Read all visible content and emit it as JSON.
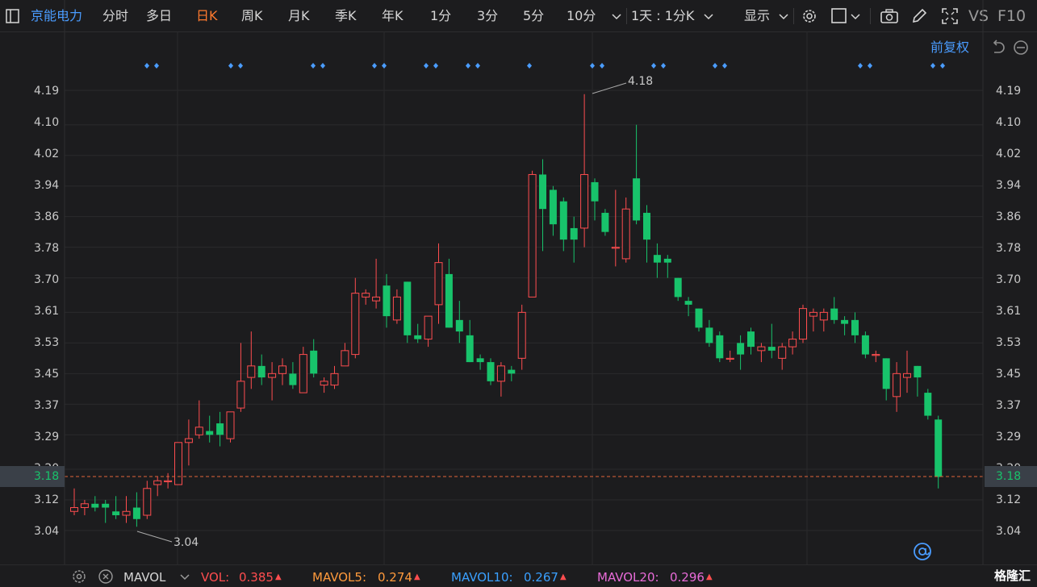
{
  "toolbar": {
    "stock_name": "京能电力",
    "periods": [
      "分时",
      "多日",
      "日K",
      "周K",
      "月K",
      "季K",
      "年K",
      "1分",
      "3分",
      "5分",
      "10分"
    ],
    "active_period": "日K",
    "multi_period": "1天 : 1分K",
    "display_label": "显示",
    "vs_label": "VS",
    "f10_label": "F10"
  },
  "subbar": {
    "adjust_label": "前复权"
  },
  "axis": {
    "ticks": [
      "4.19",
      "4.10",
      "4.02",
      "3.94",
      "3.86",
      "3.78",
      "3.70",
      "3.61",
      "3.53",
      "3.45",
      "3.37",
      "3.29",
      "3.20",
      "3.12",
      "3.04"
    ],
    "current_price": "3.18"
  },
  "annotations": {
    "high": "4.18",
    "low": "3.04"
  },
  "indicator": {
    "name": "MAVOL",
    "items": [
      {
        "label": "VOL:",
        "value": "0.385",
        "color": "#ff4d4f"
      },
      {
        "label": "MAVOL5:",
        "value": "0.274",
        "color": "#ff9a3c"
      },
      {
        "label": "MAVOL10:",
        "value": "0.267",
        "color": "#3aa0ff"
      },
      {
        "label": "MAVOL20:",
        "value": "0.296",
        "color": "#e86bd8"
      }
    ]
  },
  "brand": "格隆汇",
  "colors": {
    "up": "#ff4d4f",
    "down": "#18c36b",
    "accent": "#4a9cff",
    "grid": "#2a2a2c"
  },
  "chart_data": {
    "type": "candlestick",
    "ylim": [
      3.0,
      4.22
    ],
    "candles": [
      {
        "o": 3.09,
        "h": 3.15,
        "l": 3.08,
        "c": 3.1
      },
      {
        "o": 3.1,
        "h": 3.12,
        "l": 3.08,
        "c": 3.11
      },
      {
        "o": 3.11,
        "h": 3.13,
        "l": 3.09,
        "c": 3.1
      },
      {
        "o": 3.11,
        "h": 3.12,
        "l": 3.06,
        "c": 3.1
      },
      {
        "o": 3.09,
        "h": 3.13,
        "l": 3.07,
        "c": 3.08
      },
      {
        "o": 3.08,
        "h": 3.13,
        "l": 3.06,
        "c": 3.09
      },
      {
        "o": 3.1,
        "h": 3.14,
        "l": 3.05,
        "c": 3.07
      },
      {
        "o": 3.08,
        "h": 3.17,
        "l": 3.07,
        "c": 3.15
      },
      {
        "o": 3.16,
        "h": 3.18,
        "l": 3.13,
        "c": 3.17
      },
      {
        "o": 3.17,
        "h": 3.19,
        "l": 3.15,
        "c": 3.17
      },
      {
        "o": 3.16,
        "h": 3.26,
        "l": 3.16,
        "c": 3.27
      },
      {
        "o": 3.27,
        "h": 3.33,
        "l": 3.21,
        "c": 3.28
      },
      {
        "o": 3.29,
        "h": 3.38,
        "l": 3.28,
        "c": 3.31
      },
      {
        "o": 3.3,
        "h": 3.34,
        "l": 3.27,
        "c": 3.29
      },
      {
        "o": 3.32,
        "h": 3.35,
        "l": 3.26,
        "c": 3.29
      },
      {
        "o": 3.28,
        "h": 3.35,
        "l": 3.27,
        "c": 3.35
      },
      {
        "o": 3.36,
        "h": 3.53,
        "l": 3.35,
        "c": 3.43
      },
      {
        "o": 3.44,
        "h": 3.56,
        "l": 3.41,
        "c": 3.47
      },
      {
        "o": 3.47,
        "h": 3.5,
        "l": 3.42,
        "c": 3.44
      },
      {
        "o": 3.44,
        "h": 3.48,
        "l": 3.38,
        "c": 3.45
      },
      {
        "o": 3.45,
        "h": 3.49,
        "l": 3.42,
        "c": 3.47
      },
      {
        "o": 3.45,
        "h": 3.48,
        "l": 3.41,
        "c": 3.42
      },
      {
        "o": 3.4,
        "h": 3.52,
        "l": 3.4,
        "c": 3.5
      },
      {
        "o": 3.51,
        "h": 3.54,
        "l": 3.44,
        "c": 3.45
      },
      {
        "o": 3.42,
        "h": 3.44,
        "l": 3.4,
        "c": 3.43
      },
      {
        "o": 3.42,
        "h": 3.47,
        "l": 3.41,
        "c": 3.45
      },
      {
        "o": 3.47,
        "h": 3.53,
        "l": 3.47,
        "c": 3.51
      },
      {
        "o": 3.5,
        "h": 3.7,
        "l": 3.49,
        "c": 3.66
      },
      {
        "o": 3.65,
        "h": 3.67,
        "l": 3.63,
        "c": 3.66
      },
      {
        "o": 3.64,
        "h": 3.75,
        "l": 3.62,
        "c": 3.65
      },
      {
        "o": 3.68,
        "h": 3.71,
        "l": 3.57,
        "c": 3.6
      },
      {
        "o": 3.59,
        "h": 3.67,
        "l": 3.58,
        "c": 3.65
      },
      {
        "o": 3.69,
        "h": 3.69,
        "l": 3.53,
        "c": 3.55
      },
      {
        "o": 3.55,
        "h": 3.58,
        "l": 3.53,
        "c": 3.54
      },
      {
        "o": 3.54,
        "h": 3.59,
        "l": 3.52,
        "c": 3.6
      },
      {
        "o": 3.63,
        "h": 3.79,
        "l": 3.58,
        "c": 3.74
      },
      {
        "o": 3.71,
        "h": 3.75,
        "l": 3.57,
        "c": 3.57
      },
      {
        "o": 3.59,
        "h": 3.64,
        "l": 3.53,
        "c": 3.56
      },
      {
        "o": 3.55,
        "h": 3.59,
        "l": 3.48,
        "c": 3.48
      },
      {
        "o": 3.49,
        "h": 3.5,
        "l": 3.46,
        "c": 3.48
      },
      {
        "o": 3.48,
        "h": 3.49,
        "l": 3.42,
        "c": 3.43
      },
      {
        "o": 3.43,
        "h": 3.48,
        "l": 3.39,
        "c": 3.47
      },
      {
        "o": 3.46,
        "h": 3.47,
        "l": 3.43,
        "c": 3.45
      },
      {
        "o": 3.49,
        "h": 3.63,
        "l": 3.46,
        "c": 3.61
      },
      {
        "o": 3.65,
        "h": 3.98,
        "l": 3.65,
        "c": 3.97
      },
      {
        "o": 3.97,
        "h": 4.01,
        "l": 3.77,
        "c": 3.88
      },
      {
        "o": 3.93,
        "h": 3.94,
        "l": 3.81,
        "c": 3.84
      },
      {
        "o": 3.9,
        "h": 3.91,
        "l": 3.77,
        "c": 3.8
      },
      {
        "o": 3.83,
        "h": 3.86,
        "l": 3.74,
        "c": 3.8
      },
      {
        "o": 3.83,
        "h": 4.18,
        "l": 3.78,
        "c": 3.97
      },
      {
        "o": 3.95,
        "h": 3.96,
        "l": 3.85,
        "c": 3.9
      },
      {
        "o": 3.87,
        "h": 3.88,
        "l": 3.81,
        "c": 3.82
      },
      {
        "o": 3.78,
        "h": 3.93,
        "l": 3.73,
        "c": 3.78
      },
      {
        "o": 3.75,
        "h": 3.91,
        "l": 3.74,
        "c": 3.88
      },
      {
        "o": 3.96,
        "h": 4.1,
        "l": 3.84,
        "c": 3.85
      },
      {
        "o": 3.87,
        "h": 3.89,
        "l": 3.74,
        "c": 3.8
      },
      {
        "o": 3.76,
        "h": 3.79,
        "l": 3.7,
        "c": 3.74
      },
      {
        "o": 3.75,
        "h": 3.76,
        "l": 3.7,
        "c": 3.74
      },
      {
        "o": 3.7,
        "h": 3.7,
        "l": 3.64,
        "c": 3.65
      },
      {
        "o": 3.64,
        "h": 3.65,
        "l": 3.6,
        "c": 3.63
      },
      {
        "o": 3.62,
        "h": 3.62,
        "l": 3.56,
        "c": 3.57
      },
      {
        "o": 3.57,
        "h": 3.59,
        "l": 3.52,
        "c": 3.53
      },
      {
        "o": 3.55,
        "h": 3.56,
        "l": 3.48,
        "c": 3.49
      },
      {
        "o": 3.49,
        "h": 3.51,
        "l": 3.48,
        "c": 3.49
      },
      {
        "o": 3.53,
        "h": 3.55,
        "l": 3.46,
        "c": 3.5
      },
      {
        "o": 3.56,
        "h": 3.57,
        "l": 3.5,
        "c": 3.52
      },
      {
        "o": 3.51,
        "h": 3.53,
        "l": 3.48,
        "c": 3.52
      },
      {
        "o": 3.52,
        "h": 3.58,
        "l": 3.49,
        "c": 3.51
      },
      {
        "o": 3.49,
        "h": 3.53,
        "l": 3.46,
        "c": 3.52
      },
      {
        "o": 3.52,
        "h": 3.56,
        "l": 3.5,
        "c": 3.54
      },
      {
        "o": 3.54,
        "h": 3.63,
        "l": 3.53,
        "c": 3.62
      },
      {
        "o": 3.6,
        "h": 3.62,
        "l": 3.56,
        "c": 3.61
      },
      {
        "o": 3.59,
        "h": 3.62,
        "l": 3.56,
        "c": 3.61
      },
      {
        "o": 3.62,
        "h": 3.65,
        "l": 3.58,
        "c": 3.59
      },
      {
        "o": 3.59,
        "h": 3.6,
        "l": 3.55,
        "c": 3.58
      },
      {
        "o": 3.59,
        "h": 3.61,
        "l": 3.53,
        "c": 3.55
      },
      {
        "o": 3.55,
        "h": 3.56,
        "l": 3.49,
        "c": 3.5
      },
      {
        "o": 3.5,
        "h": 3.51,
        "l": 3.48,
        "c": 3.5
      },
      {
        "o": 3.49,
        "h": 3.49,
        "l": 3.38,
        "c": 3.41
      },
      {
        "o": 3.39,
        "h": 3.48,
        "l": 3.35,
        "c": 3.45
      },
      {
        "o": 3.44,
        "h": 3.51,
        "l": 3.4,
        "c": 3.45
      },
      {
        "o": 3.47,
        "h": 3.47,
        "l": 3.39,
        "c": 3.44
      },
      {
        "o": 3.4,
        "h": 3.41,
        "l": 3.33,
        "c": 3.34
      },
      {
        "o": 3.33,
        "h": 3.34,
        "l": 3.15,
        "c": 3.18
      }
    ]
  }
}
